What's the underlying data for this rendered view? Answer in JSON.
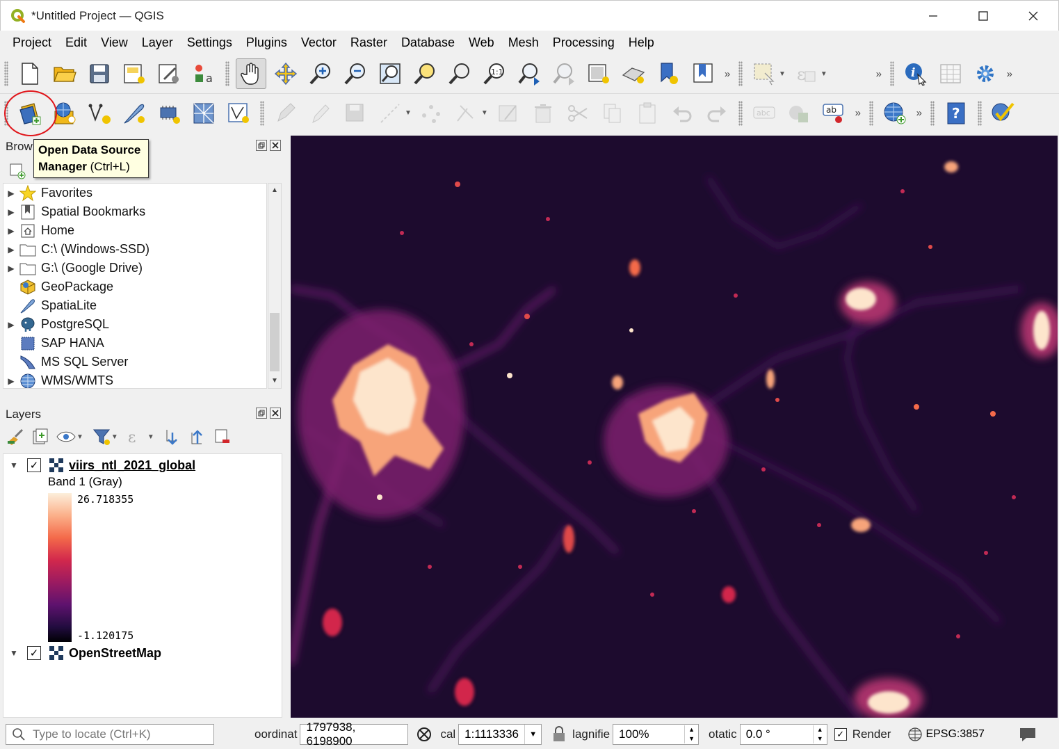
{
  "window": {
    "title": "*Untitled Project — QGIS",
    "minimize": "—",
    "maximize": "☐",
    "close": "✕"
  },
  "menubar": [
    "Project",
    "Edit",
    "View",
    "Layer",
    "Settings",
    "Plugins",
    "Vector",
    "Raster",
    "Database",
    "Web",
    "Mesh",
    "Processing",
    "Help"
  ],
  "tooltip": {
    "line1": "Open Data Source",
    "line2_bold": "Manager",
    "line2_rest": " (Ctrl+L)"
  },
  "browser_panel": {
    "title": "Brow",
    "items": [
      {
        "label": "Favorites",
        "icon": "star-icon",
        "expandable": true
      },
      {
        "label": "Spatial Bookmarks",
        "icon": "bookmark-icon",
        "expandable": true
      },
      {
        "label": "Home",
        "icon": "home-icon",
        "expandable": true
      },
      {
        "label": "C:\\ (Windows-SSD)",
        "icon": "folder-icon",
        "expandable": true
      },
      {
        "label": "G:\\ (Google Drive)",
        "icon": "folder-icon",
        "expandable": true
      },
      {
        "label": "GeoPackage",
        "icon": "geopackage-icon",
        "expandable": false
      },
      {
        "label": "SpatiaLite",
        "icon": "spatialite-icon",
        "expandable": false
      },
      {
        "label": "PostgreSQL",
        "icon": "postgresql-icon",
        "expandable": true
      },
      {
        "label": "SAP HANA",
        "icon": "sap-hana-icon",
        "expandable": false
      },
      {
        "label": "MS SQL Server",
        "icon": "mssql-icon",
        "expandable": false
      },
      {
        "label": "WMS/WMTS",
        "icon": "globe-icon",
        "expandable": true
      }
    ]
  },
  "layers_panel": {
    "title": "Layers",
    "layers": [
      {
        "name": "viirs_ntl_2021_global",
        "checked": true,
        "band": "Band 1 (Gray)",
        "max": "26.718355",
        "min": "-1.120175"
      },
      {
        "name": "OpenStreetMap",
        "checked": true
      }
    ]
  },
  "statusbar": {
    "locate_placeholder": "Type to locate (Ctrl+K)",
    "coordinate_label": "oordinat",
    "coordinate_value": "1797938, 6198900",
    "scale_label": "cal",
    "scale_value": "1:1113336",
    "magnifier_label": "lagnifie",
    "magnifier_value": "100%",
    "rotation_label": "otatic",
    "rotation_value": "0.0 °",
    "render_label": "Render",
    "render_checked": true,
    "crs": "EPSG:3857"
  },
  "colors": {
    "map_background": "#1d0b2e",
    "ramp_top": "#fcefdb",
    "ramp_bottom": "#000004",
    "highlight_circle": "#e0161b",
    "tooltip_bg": "#ffffe1"
  }
}
